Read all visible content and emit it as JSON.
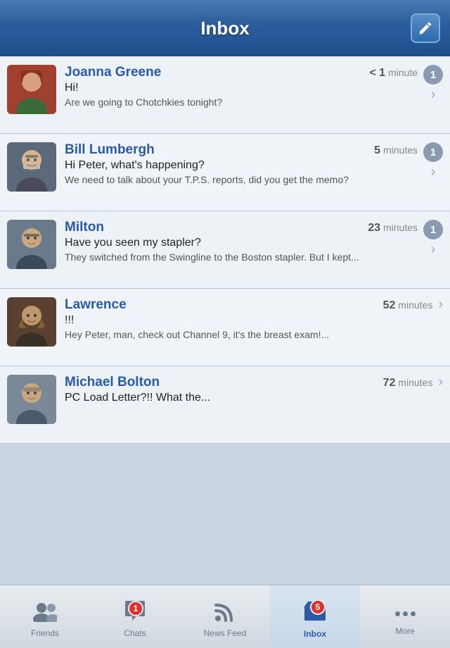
{
  "header": {
    "title": "Inbox",
    "compose_label": "compose"
  },
  "messages": [
    {
      "id": "joanna",
      "sender": "Joanna Greene",
      "timestamp_num": "< 1",
      "timestamp_unit": "minute",
      "first_line": "Hi!",
      "preview": "Are we going to Chotchkies tonight?",
      "badge": "1",
      "avatar_color1": "#c87060",
      "avatar_color2": "#7a3020"
    },
    {
      "id": "bill",
      "sender": "Bill Lumbergh",
      "timestamp_num": "5",
      "timestamp_unit": "minutes",
      "first_line": "Hi Peter, what's happening?",
      "preview": "We need to talk about your T.P.S. reports, did you get the memo?",
      "badge": "1",
      "avatar_color1": "#7a8a9a",
      "avatar_color2": "#4a5a6a"
    },
    {
      "id": "milton",
      "sender": "Milton",
      "timestamp_num": "23",
      "timestamp_unit": "minutes",
      "first_line": "Have you seen my stapler?",
      "preview": "They switched from the Swingline to the Boston stapler. But I kept...",
      "badge": "1",
      "avatar_color1": "#8a9aaa",
      "avatar_color2": "#5a6a7a"
    },
    {
      "id": "lawrence",
      "sender": "Lawrence",
      "timestamp_num": "52",
      "timestamp_unit": "minutes",
      "first_line": "!!!",
      "preview": "Hey Peter, man, check out Channel 9, it's the breast exam!...",
      "badge": null,
      "avatar_color1": "#6a5a4a",
      "avatar_color2": "#3a2a1a"
    },
    {
      "id": "michael",
      "sender": "Michael Bolton",
      "timestamp_num": "72",
      "timestamp_unit": "minutes",
      "first_line": "PC Load Letter?!! What the...",
      "preview": "",
      "badge": null,
      "avatar_color1": "#8a9aaa",
      "avatar_color2": "#5a6a7a"
    }
  ],
  "tabs": [
    {
      "id": "friends",
      "label": "Friends",
      "icon": "friends",
      "badge": null,
      "active": false
    },
    {
      "id": "chats",
      "label": "Chats",
      "icon": "chats",
      "badge": "1",
      "active": false
    },
    {
      "id": "newsfeed",
      "label": "News Feed",
      "icon": "newsfeed",
      "badge": null,
      "active": false
    },
    {
      "id": "inbox",
      "label": "Inbox",
      "icon": "inbox",
      "badge": "5",
      "active": true
    },
    {
      "id": "more",
      "label": "More",
      "icon": "dots",
      "badge": null,
      "active": false
    }
  ]
}
